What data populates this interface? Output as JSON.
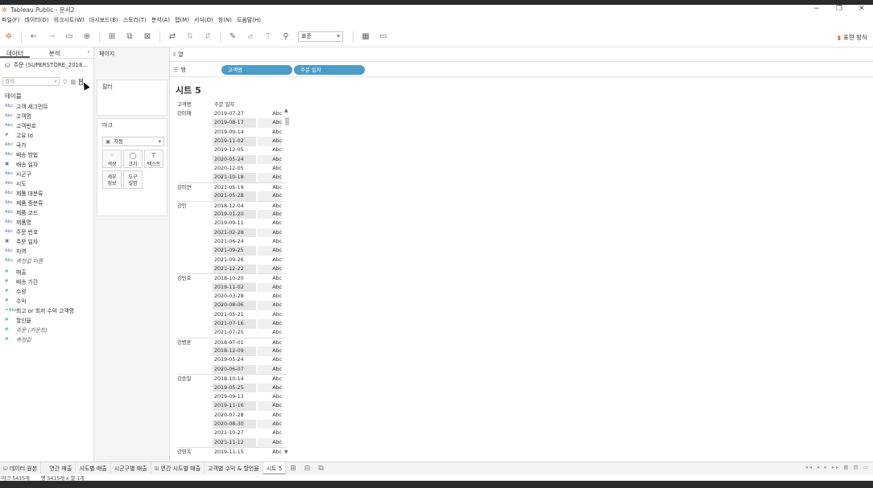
{
  "window": {
    "title": "Tableau Public - 문서2",
    "min": "−",
    "restore": "❐",
    "close": "✕"
  },
  "menu": [
    "파일(F)",
    "데이터(D)",
    "워크시트(W)",
    "대시보드(B)",
    "스토리(T)",
    "분석(A)",
    "맵(M)",
    "서식(O)",
    "창(N)",
    "도움말(H)"
  ],
  "toolbar": {
    "select_value": "표준",
    "show_me": "표현 방식",
    "icons": [
      "tableau-logo-icon",
      "undo-icon",
      "redo-icon",
      "save-icon",
      "add-datasource-icon",
      "new-sheet-icon",
      "duplicate-icon",
      "clear-sheet-icon",
      "swap-icon",
      "sort-asc-icon",
      "sort-desc-icon",
      "highlight-icon",
      "group-icon",
      "label-icon",
      "pin-icon",
      "fit-icon",
      "presentation-icon"
    ]
  },
  "data_pane": {
    "tabs": [
      "데이터",
      "분석"
    ],
    "datasource": "주문 (SUPERSTORE_2018...",
    "search_placeholder": "검색",
    "table_heading": "테이블",
    "dimensions": [
      {
        "type": "Abc",
        "name": "고객 세그먼트"
      },
      {
        "type": "Abc",
        "name": "고객명"
      },
      {
        "type": "Abc",
        "name": "고객번호"
      },
      {
        "type": "#",
        "name": "고유 Id"
      },
      {
        "type": "Abc",
        "name": "국가"
      },
      {
        "type": "Abc",
        "name": "배송 방법"
      },
      {
        "type": "date",
        "name": "배송 일자"
      },
      {
        "type": "Abc",
        "name": "시군구"
      },
      {
        "type": "Abc",
        "name": "시도"
      },
      {
        "type": "Abc",
        "name": "제품 대분류"
      },
      {
        "type": "Abc",
        "name": "제품 중분류"
      },
      {
        "type": "Abc",
        "name": "제품 코드"
      },
      {
        "type": "Abc",
        "name": "제품명"
      },
      {
        "type": "Abc",
        "name": "주문 번호"
      },
      {
        "type": "date",
        "name": "주문 일자"
      },
      {
        "type": "Abc",
        "name": "지역"
      },
      {
        "type": "Abc",
        "name": "측정값 이름",
        "italic": true
      }
    ],
    "measures": [
      {
        "type": "#",
        "name": "매출"
      },
      {
        "type": "#",
        "name": "배송 기간"
      },
      {
        "type": "#",
        "name": "수량"
      },
      {
        "type": "#",
        "name": "수익"
      },
      {
        "type": "=Abc",
        "name": "최고 or 최저 수익 고객명"
      },
      {
        "type": "#",
        "name": "할인율"
      },
      {
        "type": "#",
        "name": "주문 (카운트)",
        "italic": true
      },
      {
        "type": "#",
        "name": "측정값",
        "italic": true
      }
    ]
  },
  "cards": {
    "pages": "페이지",
    "filters": "필터",
    "marks": "마크",
    "mark_type": "자동",
    "buttons": [
      {
        "glyph": "⁘",
        "label": "색상"
      },
      {
        "glyph": "◯",
        "label": "크기"
      },
      {
        "glyph": "T",
        "label": "텍스트"
      },
      {
        "glyph": "",
        "label": "세부\n정보"
      },
      {
        "glyph": "",
        "label": "도구\n설명"
      }
    ]
  },
  "shelves": {
    "columns_label": "열",
    "rows_label": "행",
    "row_pills": [
      "고객명",
      "주문 일자"
    ]
  },
  "sheet": {
    "title": "시트 5",
    "headers": [
      "고객명",
      "주문 일자"
    ],
    "groups": [
      {
        "customer": "강미애",
        "dates": [
          "2019-07-27",
          "2019-08-17",
          "2019-09-14",
          "2019-11-02",
          "2019-12-05",
          "2020-05-24",
          "2020-12-05",
          "2021-10-18"
        ]
      },
      {
        "customer": "강미연",
        "dates": [
          "2021-05-19",
          "2021-05-28"
        ]
      },
      {
        "customer": "강민",
        "dates": [
          "2018-12-04",
          "2019-01-20",
          "2019-09-11",
          "2021-02-28",
          "2021-06-24",
          "2021-09-25",
          "2021-09-26",
          "2021-12-22"
        ]
      },
      {
        "customer": "강민호",
        "dates": [
          "2018-10-20",
          "2019-11-02",
          "2020-03-28",
          "2020-08-06",
          "2021-05-21",
          "2021-07-16",
          "2021-07-25"
        ]
      },
      {
        "customer": "강병훈",
        "dates": [
          "2018-07-01",
          "2018-12-09",
          "2019-05-24",
          "2020-06-07"
        ]
      },
      {
        "customer": "강승일",
        "dates": [
          "2018-10-14",
          "2019-05-25",
          "2019-09-13",
          "2019-11-16",
          "2020-07-28",
          "2020-08-30",
          "2021-10-27",
          "2021-11-12"
        ]
      },
      {
        "customer": "강영옥",
        "dates": [
          "2019-11-15"
        ]
      }
    ],
    "cell_value": "Abc"
  },
  "tabs": {
    "items": [
      "데이터 원본",
      "연간 매출",
      "시도별 매출",
      "시군구별 매출",
      "연간 시도별 매출",
      "고객별 수익 & 할인율",
      "시트 5"
    ],
    "active": "시트 5"
  },
  "status": {
    "marks": "마크 5415개",
    "rows_cols": "행 5415개 x 열 1개"
  }
}
